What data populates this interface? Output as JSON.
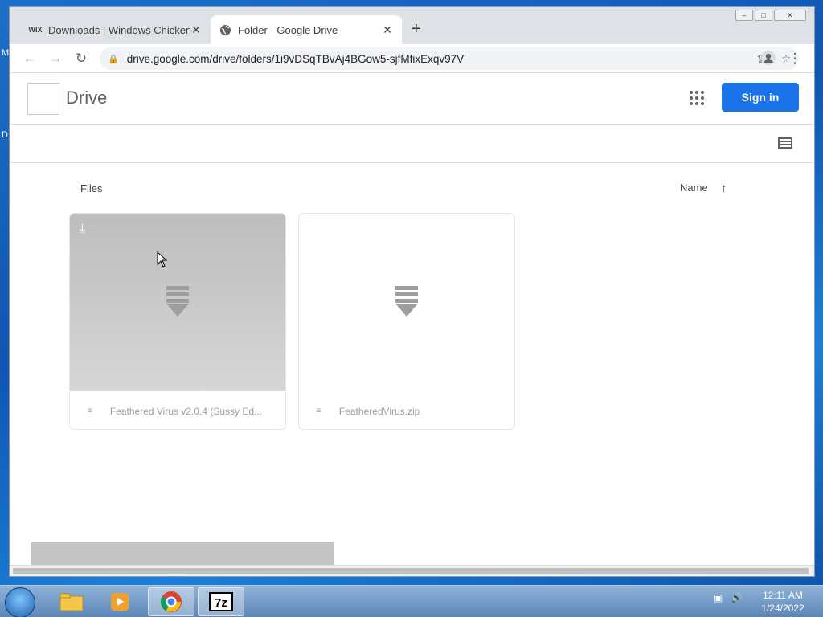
{
  "browser": {
    "tabs": [
      {
        "label": "Downloads | Windows Chicken",
        "favicon": "wix-icon"
      },
      {
        "label": "Folder - Google Drive",
        "favicon": "globe-icon"
      }
    ],
    "url": "drive.google.com/drive/folders/1i9vDSqTBvAj4BGow5-sjfMfixExqv97V"
  },
  "drive": {
    "title": "Drive",
    "signin_label": "Sign in",
    "files_label": "Files",
    "sort_label": "Name",
    "files": [
      {
        "name": "Feathered Virus v2.0.4 (Sussy Ed..."
      },
      {
        "name": "FeatheredVirus.zip"
      }
    ]
  },
  "taskbar": {
    "time": "12:11 AM",
    "date": "1/24/2022"
  }
}
